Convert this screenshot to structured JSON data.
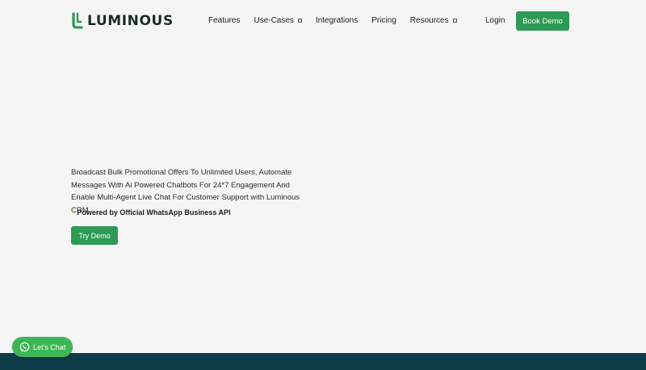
{
  "header": {
    "logo_text": "LUMINOUS",
    "nav": [
      {
        "label": "Features",
        "has_dropdown": false
      },
      {
        "label": "Use-Cases",
        "has_dropdown": true
      },
      {
        "label": "Integrations",
        "has_dropdown": false
      },
      {
        "label": "Pricing",
        "has_dropdown": false
      },
      {
        "label": "Resources",
        "has_dropdown": true
      }
    ],
    "login_label": "Login",
    "book_demo_label": "Book Demo"
  },
  "hero": {
    "description": "Broadcast Bulk Promotional Offers To Unlimited Users, Automate Messages With Ai Powered Chatbots For 24*7 Engagement And Enable Multi-Agent Live Chat For Customer Support with Luminous CRM.",
    "powered_by": "Powered by Official WhatsApp Business API",
    "try_demo_label": "Try Demo"
  },
  "chat_widget": {
    "label": "Let's Chat"
  },
  "colors": {
    "brand_green": "#2e9a55",
    "chat_green": "#3bb855",
    "footer_band": "#0e3b48",
    "background": "#f5f5f5"
  },
  "icons": {
    "logo": "luminous-logo-icon",
    "powered": "lightning-icon",
    "chat": "whatsapp-icon"
  }
}
